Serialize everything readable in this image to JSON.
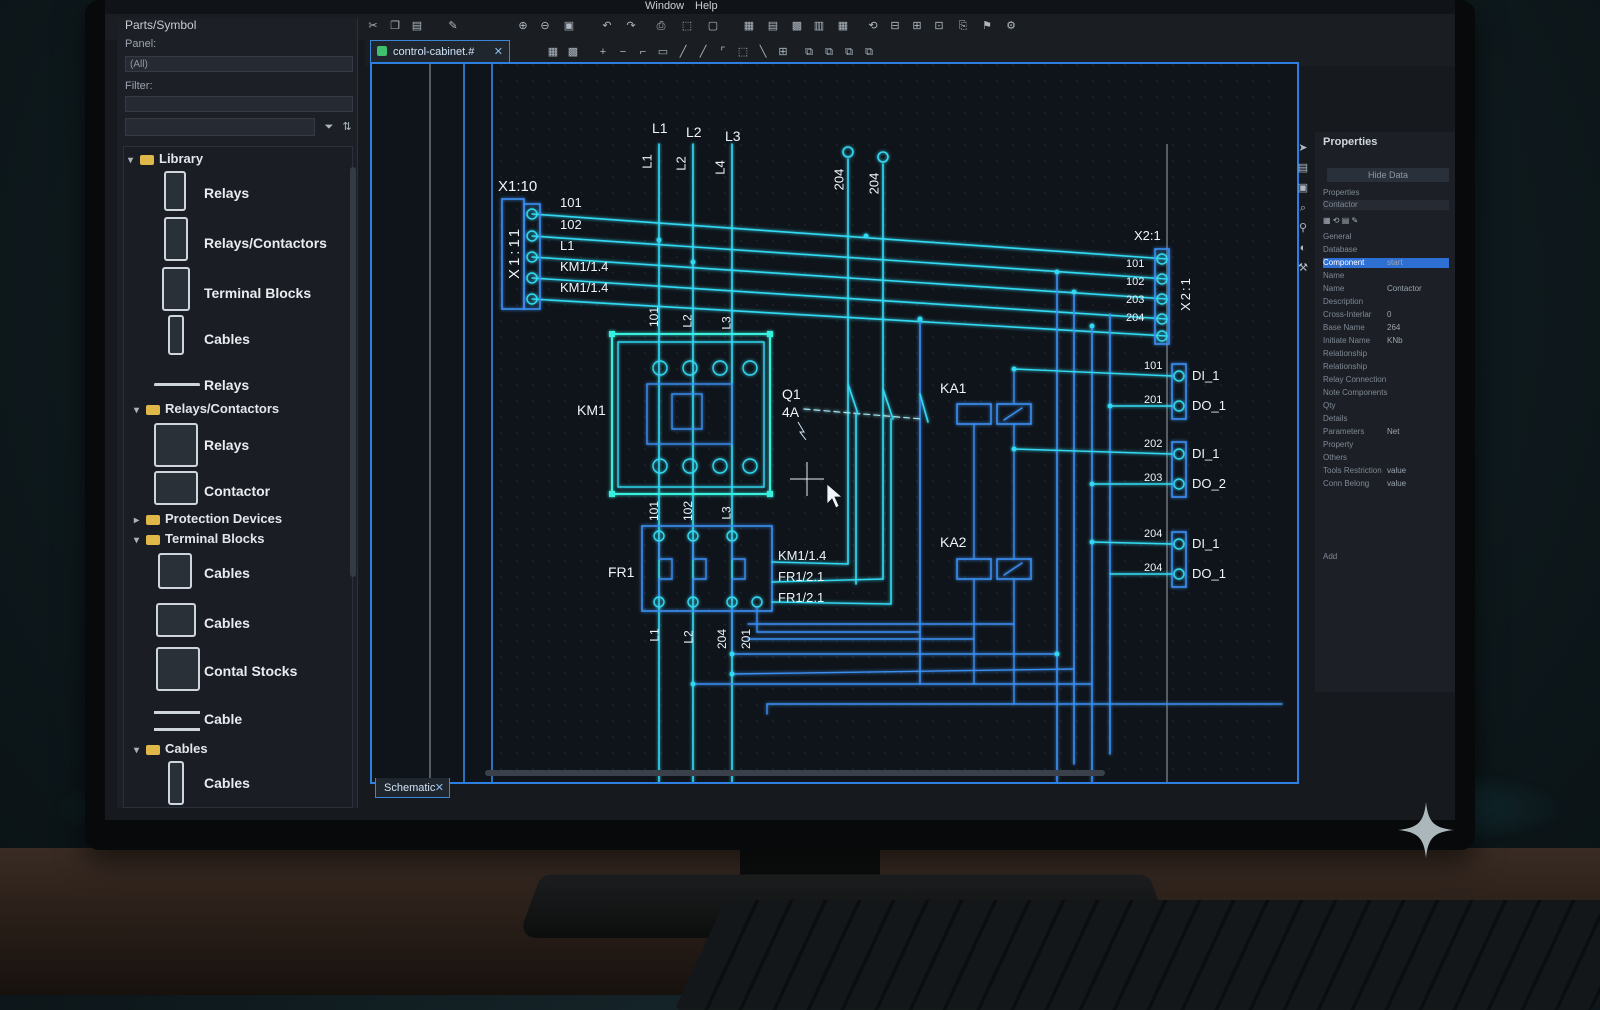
{
  "menubar": {
    "window": "Window",
    "help": "Help"
  },
  "left_panel": {
    "title": "Parts/Symbol",
    "panel_label": "Panel:",
    "panel_value": "(All)",
    "filter_label": "Filter:",
    "tree": [
      {
        "kind": "folder",
        "label": "Library"
      },
      {
        "kind": "item",
        "label": "Relays"
      },
      {
        "kind": "item",
        "label": "Relays/Contactors"
      },
      {
        "kind": "item",
        "label": "Terminal Blocks"
      },
      {
        "kind": "item",
        "label": "Cables"
      },
      {
        "kind": "item",
        "label": "Relays"
      },
      {
        "kind": "folder",
        "label": "Relays/Contactors"
      },
      {
        "kind": "item",
        "label": "Relays"
      },
      {
        "kind": "item",
        "label": "Contactor"
      },
      {
        "kind": "folder",
        "label": "Protection Devices"
      },
      {
        "kind": "folder",
        "label": "Terminal Blocks"
      },
      {
        "kind": "item",
        "label": "Cables"
      },
      {
        "kind": "item",
        "label": "Cables"
      },
      {
        "kind": "item",
        "label": "Contal Stocks"
      },
      {
        "kind": "item",
        "label": "Cable"
      },
      {
        "kind": "folder",
        "label": "Cables"
      },
      {
        "kind": "item",
        "label": "Cables"
      }
    ]
  },
  "document": {
    "tab_label": "control-cabinet.# ",
    "sheet_tab": "Schematic"
  },
  "schematic": {
    "phase_labels_top": [
      "L1",
      "L2",
      "L3"
    ],
    "phase_labels_vert": [
      "L1",
      "L2",
      "L4"
    ],
    "wire_204_a": "204",
    "wire_204_b": "204",
    "terminal_x1_name": "X1:10",
    "terminal_x1_vert": "X1:11",
    "x1_labels": [
      "101",
      "102",
      "L1",
      "KM1/1.4",
      "KM1/1.4"
    ],
    "terminal_x2_name": "X2:1",
    "terminal_x2_vert": "X2:1",
    "x2_labels": [
      "101",
      "102",
      "203",
      "204"
    ],
    "km1_label": "KM1",
    "km1_top_labels": [
      "101",
      "L2",
      "L3"
    ],
    "km1_bottom_labels": [
      "101",
      "102",
      "L3"
    ],
    "q1_label": "Q1",
    "q1_rating": "4A",
    "ka1_label": "KA1",
    "ka2_label": "KA2",
    "fr1_label": "FR1",
    "fr1_refs": [
      "KM1/1.4",
      "FR1/2.1",
      "FR1/2.1"
    ],
    "fr1_bottom_labels": [
      "L1",
      "L2",
      "204",
      "201"
    ],
    "io_wire_labels": [
      "101",
      "201",
      "202",
      "203",
      "204",
      "204"
    ],
    "io_labels": [
      "DI_1",
      "DO_1",
      "DI_1",
      "DO_2",
      "DI_1",
      "DO_1"
    ]
  },
  "right_panel": {
    "title": "Properties",
    "button": "Hide Data",
    "properties_label": "Properties",
    "type_value": "Contactor",
    "rows": [
      {
        "k": "General",
        "v": ""
      },
      {
        "k": "Database",
        "v": ""
      },
      {
        "k": "Component",
        "v": "start"
      },
      {
        "k": "Name",
        "v": ""
      },
      {
        "k": "Name",
        "v": "Contactor"
      },
      {
        "k": "Description",
        "v": ""
      },
      {
        "k": "Cross-Interlar",
        "v": "0"
      },
      {
        "k": "Base Name",
        "v": "264"
      },
      {
        "k": "Initiate Name",
        "v": "KNb"
      },
      {
        "k": "Relationship",
        "v": ""
      },
      {
        "k": "Relationship",
        "v": ""
      },
      {
        "k": "Relay Connection",
        "v": ""
      },
      {
        "k": "Note Components",
        "v": ""
      },
      {
        "k": "Qty",
        "v": ""
      },
      {
        "k": "Details",
        "v": ""
      },
      {
        "k": "Parameters",
        "v": "Net"
      },
      {
        "k": "Property",
        "v": ""
      },
      {
        "k": "Others",
        "v": ""
      },
      {
        "k": "Tools Restriction",
        "v": "value"
      },
      {
        "k": "Conn Belong",
        "v": "value"
      }
    ],
    "footer": "Add"
  },
  "colors": {
    "wire_cyan": "#33d9f2",
    "wire_blue": "#3a8ef0",
    "selection": "#39f0e0",
    "canvas_bg": "#0f141a",
    "frame_blue": "#2f7fe0"
  }
}
